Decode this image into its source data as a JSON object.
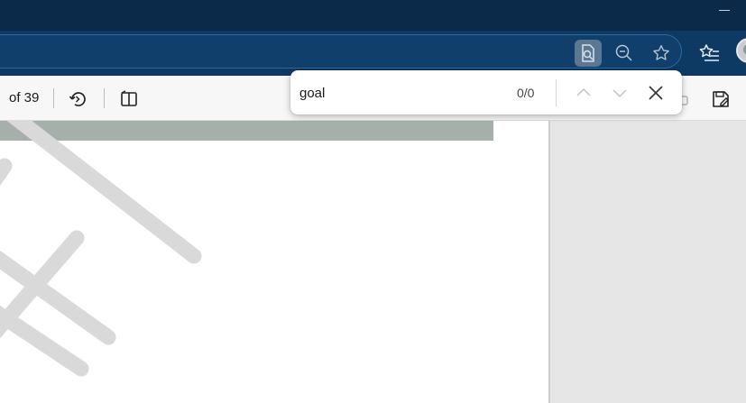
{
  "window": {
    "minimize_icon": "minimize-icon"
  },
  "navbar": {
    "icons": [
      "page-search-icon",
      "zoom-out-icon",
      "favorite-star-icon",
      "favorites-list-icon"
    ],
    "profile_icon": "profile-avatar"
  },
  "pdf_toolbar": {
    "page_count": "of 39",
    "icons": [
      "rotate-icon",
      "page-view-icon",
      "save-icon"
    ]
  },
  "find_bar": {
    "query": "goal",
    "match_count": "0/0",
    "icons": [
      "previous-match-icon",
      "next-match-icon",
      "close-icon"
    ]
  },
  "colors": {
    "titlebar": "#0b2a4a",
    "navbar": "#0d3a63",
    "toolbar": "#f7f7f7",
    "page": "#ffffff",
    "watermark": "#d9d9d9",
    "header_band": "#a6b0ab"
  }
}
